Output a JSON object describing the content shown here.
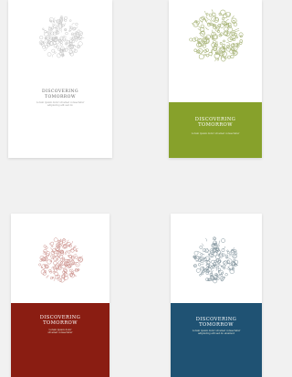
{
  "covers": [
    {
      "title": "DISCOVERING\nTOMORROW",
      "subtitle": "Lorem ipsum dolor sit amet consectetur\nadipiscing elit sed do",
      "ornament_color": "#c3c3c3",
      "accent_color": "#ffffff"
    },
    {
      "title": "DISCOVERING\nTOMORROW",
      "subtitle": "Lorem ipsum dolor sit amet consectetur",
      "ornament_color": "#a9b57a",
      "accent_color": "#87a12b"
    },
    {
      "title": "DISCOVERING\nTOMORROW",
      "subtitle": "Lorem ipsum dolor\nsit amet consectetur",
      "ornament_color": "#c98c87",
      "accent_color": "#8a1d12"
    },
    {
      "title": "DISCOVERING\nTOMORROW",
      "subtitle": "Lorem ipsum dolor sit amet consectetur\nadipiscing elit sed do eiusmod",
      "ornament_color": "#7d8f99",
      "accent_color": "#1f5273"
    }
  ]
}
